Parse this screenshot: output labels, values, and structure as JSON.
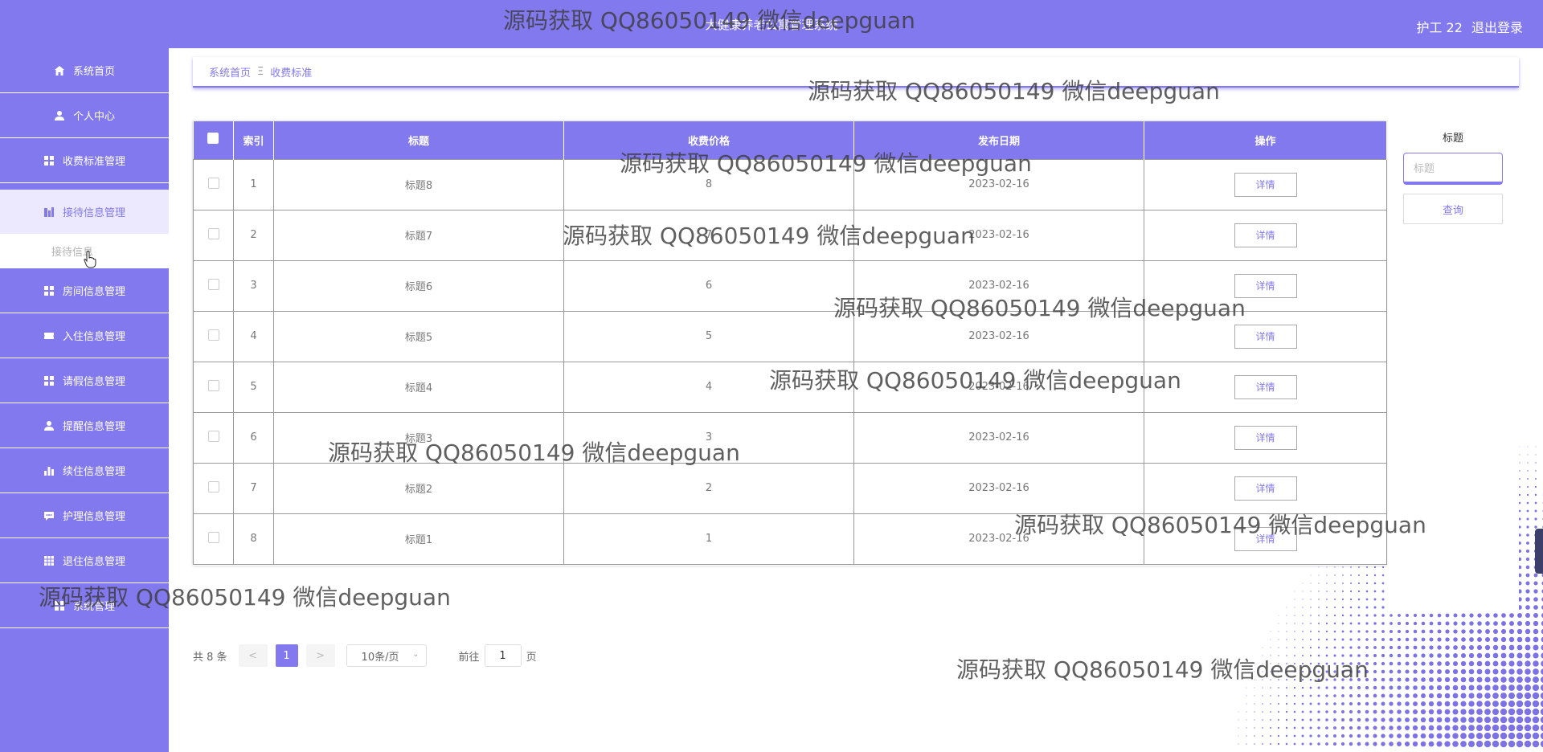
{
  "header": {
    "title": "大健康养老公寓管理系统",
    "user": "护工 22",
    "logout": "退出登录"
  },
  "sidebar": {
    "items": [
      {
        "label": "系统首页",
        "icon": "home-icon"
      },
      {
        "label": "个人中心",
        "icon": "user-icon"
      },
      {
        "label": "收费标准管理",
        "icon": "grid-icon"
      },
      {
        "label": "接待信息管理",
        "icon": "building-icon",
        "active": true
      },
      {
        "label": "房间信息管理",
        "icon": "grid-icon"
      },
      {
        "label": "入住信息管理",
        "icon": "ticket-icon"
      },
      {
        "label": "请假信息管理",
        "icon": "grid-icon"
      },
      {
        "label": "提醒信息管理",
        "icon": "user-icon"
      },
      {
        "label": "续住信息管理",
        "icon": "bar-chart-icon"
      },
      {
        "label": "护理信息管理",
        "icon": "chat-icon"
      },
      {
        "label": "退住信息管理",
        "icon": "table-icon"
      },
      {
        "label": "系统管理",
        "icon": "grid-icon"
      }
    ],
    "submenu": {
      "label": "接待信息"
    }
  },
  "breadcrumb": {
    "home": "系统首页",
    "separator": "Ξ",
    "current": "收费标准"
  },
  "table": {
    "columns": [
      "",
      "索引",
      "标题",
      "收费价格",
      "发布日期",
      "操作"
    ],
    "rows": [
      {
        "index": "1",
        "title": "标题8",
        "price": "8",
        "date": "2023-02-16",
        "action": "详情"
      },
      {
        "index": "2",
        "title": "标题7",
        "price": "7",
        "date": "2023-02-16",
        "action": "详情"
      },
      {
        "index": "3",
        "title": "标题6",
        "price": "6",
        "date": "2023-02-16",
        "action": "详情"
      },
      {
        "index": "4",
        "title": "标题5",
        "price": "5",
        "date": "2023-02-16",
        "action": "详情"
      },
      {
        "index": "5",
        "title": "标题4",
        "price": "4",
        "date": "2023-02-16",
        "action": "详情"
      },
      {
        "index": "6",
        "title": "标题3",
        "price": "3",
        "date": "2023-02-16",
        "action": "详情"
      },
      {
        "index": "7",
        "title": "标题2",
        "price": "2",
        "date": "2023-02-16",
        "action": "详情"
      },
      {
        "index": "8",
        "title": "标题1",
        "price": "1",
        "date": "2023-02-16",
        "action": "详情"
      }
    ]
  },
  "pagination": {
    "total": "共 8 条",
    "prev": "<",
    "current": "1",
    "next": ">",
    "page_size": "10条/页",
    "goto_label": "前往",
    "goto_value": "1",
    "goto_unit": "页"
  },
  "search": {
    "label": "标题",
    "placeholder": "标题",
    "button": "查询"
  },
  "watermark": "源码获取 QQ86050149 微信deepguan",
  "colors": {
    "accent": "#8379ef",
    "active_bg": "#ece9ff"
  }
}
